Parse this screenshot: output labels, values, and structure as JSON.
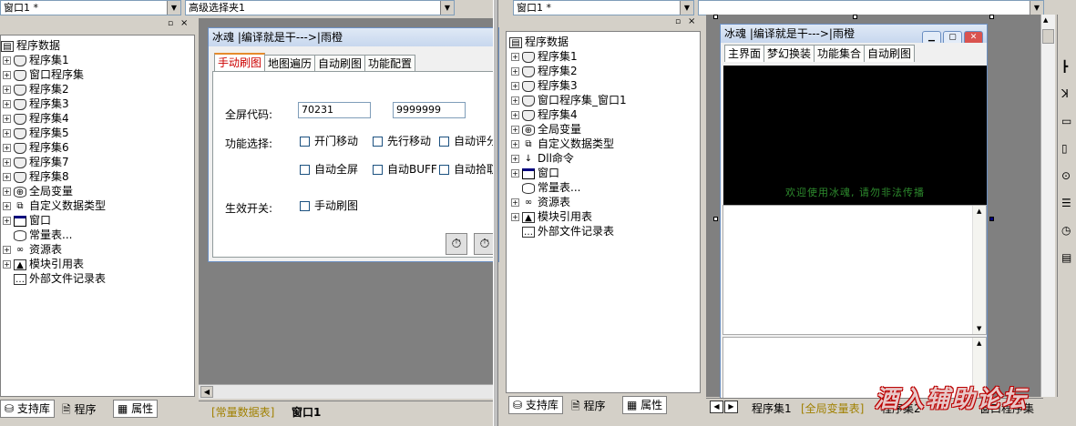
{
  "left": {
    "window_combo": "窗口1 *",
    "selector_combo": "高级选择夹1",
    "tree": {
      "root": "程序数据",
      "items": [
        "程序集1",
        "窗口程序集",
        "程序集2",
        "程序集3",
        "程序集4",
        "程序集5",
        "程序集6",
        "程序集7",
        "程序集8",
        "全局变量",
        "自定义数据类型",
        "窗口",
        "常量表...",
        "资源表",
        "模块引用表",
        "外部文件记录表"
      ]
    },
    "bottom_tabs": [
      "支持库",
      "程序",
      "属性"
    ],
    "doc_tabs": [
      "[常量数据表]",
      "窗口1"
    ]
  },
  "form1": {
    "title": "冰魂 |编译就是干--->|雨橙",
    "tabs": [
      "手动刷图",
      "地图遍历",
      "自动刷图",
      "功能配置"
    ],
    "fullscreen_label": "全屏代码:",
    "code1": "70231",
    "code2": "9999999",
    "func_label": "功能选择:",
    "checks_row1": [
      "开门移动",
      "先行移动",
      "自动评分"
    ],
    "checks_row2": [
      "自动全屏",
      "自动BUFF",
      "自动拾取"
    ],
    "effect_label": "生效开关:",
    "effect_check": "手动刷图",
    "icon_buttons": [
      "stopwatch-icon",
      "stopwatch-icon"
    ]
  },
  "right": {
    "window_combo": "窗口1 *",
    "tree": {
      "root": "程序数据",
      "items": [
        "程序集1",
        "程序集2",
        "程序集3",
        "窗口程序集_窗口1",
        "程序集4",
        "全局变量",
        "自定义数据类型",
        "Dll命令",
        "窗口",
        "常量表...",
        "资源表",
        "模块引用表",
        "外部文件记录表"
      ]
    },
    "bottom_tabs": [
      "支持库",
      "程序",
      "属性"
    ],
    "doc_tabs": [
      "程序集1",
      "[全局变量表]",
      "程序集2",
      "窗口程序集"
    ]
  },
  "form2": {
    "title": "冰魂 |编译就是干--->|雨橙",
    "tabs": [
      "主界面",
      "梦幻换装",
      "功能集合",
      "自动刷图"
    ],
    "banner": "欢迎使用冰魂, 请勿非法传播"
  },
  "watermark": "酒入辅助论坛",
  "colors": {
    "accent_red": "#c00000",
    "banner_green": "#2d8a2d",
    "form_blue": "#6b8fc2"
  }
}
